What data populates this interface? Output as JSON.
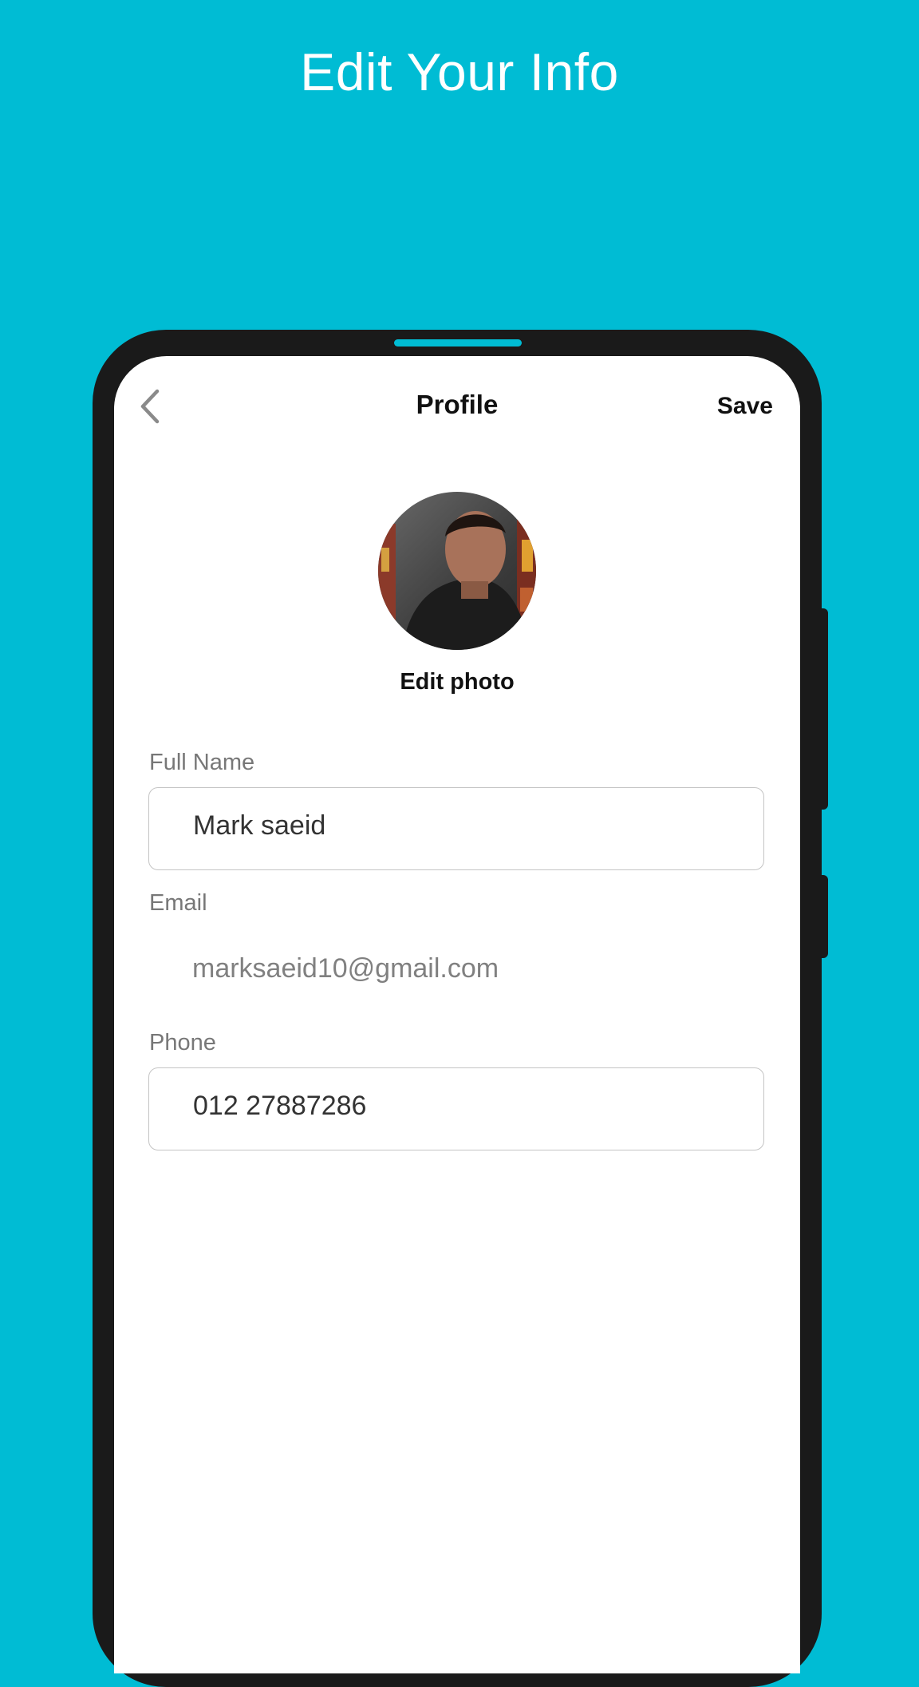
{
  "banner": {
    "title": "Edit Your Info"
  },
  "header": {
    "title": "Profile",
    "save_label": "Save",
    "back_icon": "chevron-left-icon"
  },
  "profile": {
    "edit_photo_label": "Edit photo"
  },
  "form": {
    "full_name": {
      "label": "Full Name",
      "value": "Mark saeid"
    },
    "email": {
      "label": "Email",
      "value": "marksaeid10@gmail.com"
    },
    "phone": {
      "label": "Phone",
      "value": "012 27887286"
    }
  },
  "colors": {
    "background": "#00bcd4",
    "phone_frame": "#1a1a1a",
    "screen": "#ffffff",
    "label": "#777777"
  }
}
